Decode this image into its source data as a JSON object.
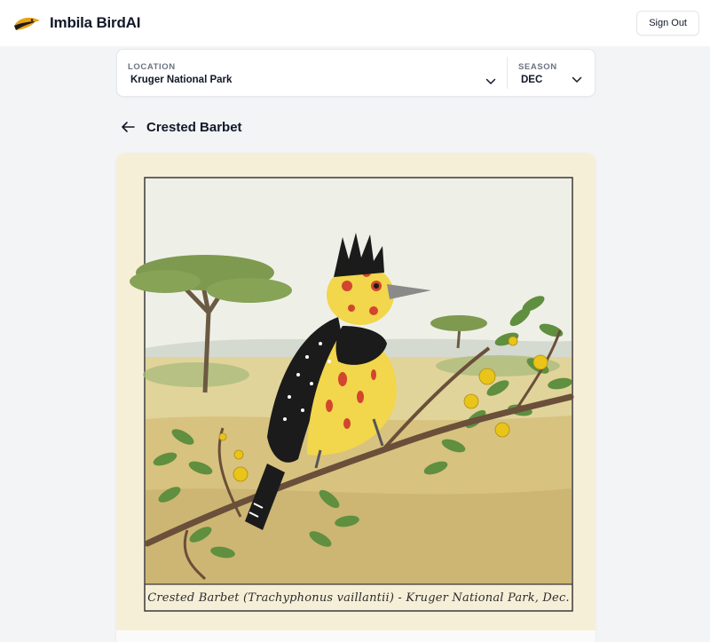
{
  "header": {
    "app_title": "Imbila BirdAI",
    "logo_icon": "bird-head-logo",
    "signout_label": "Sign Out"
  },
  "filters": {
    "location_label": "LOCATION",
    "location_value": "Kruger National Park",
    "season_label": "SEASON",
    "season_value": "DEC"
  },
  "page": {
    "title": "Crested Barbet",
    "back_icon": "arrow-left-icon"
  },
  "illustration": {
    "caption": "Crested Barbet (Trachyphonus vaillantii) - Kruger National Park, Dec.",
    "colors": {
      "paper": "#f6efd8",
      "sky": "#eef0e6",
      "grass": "#d9c98a",
      "foliage": "#6f9a4a",
      "bird_yellow": "#f2d64b",
      "bird_black": "#1b1b1b",
      "bird_red": "#d2452e",
      "flower": "#e9c419"
    }
  },
  "theme": {
    "background": "#f3f4f6",
    "surface": "#ffffff",
    "border": "#e5e7eb",
    "text": "#111827",
    "muted": "#6b7280",
    "logo_color": "#e8a317"
  }
}
